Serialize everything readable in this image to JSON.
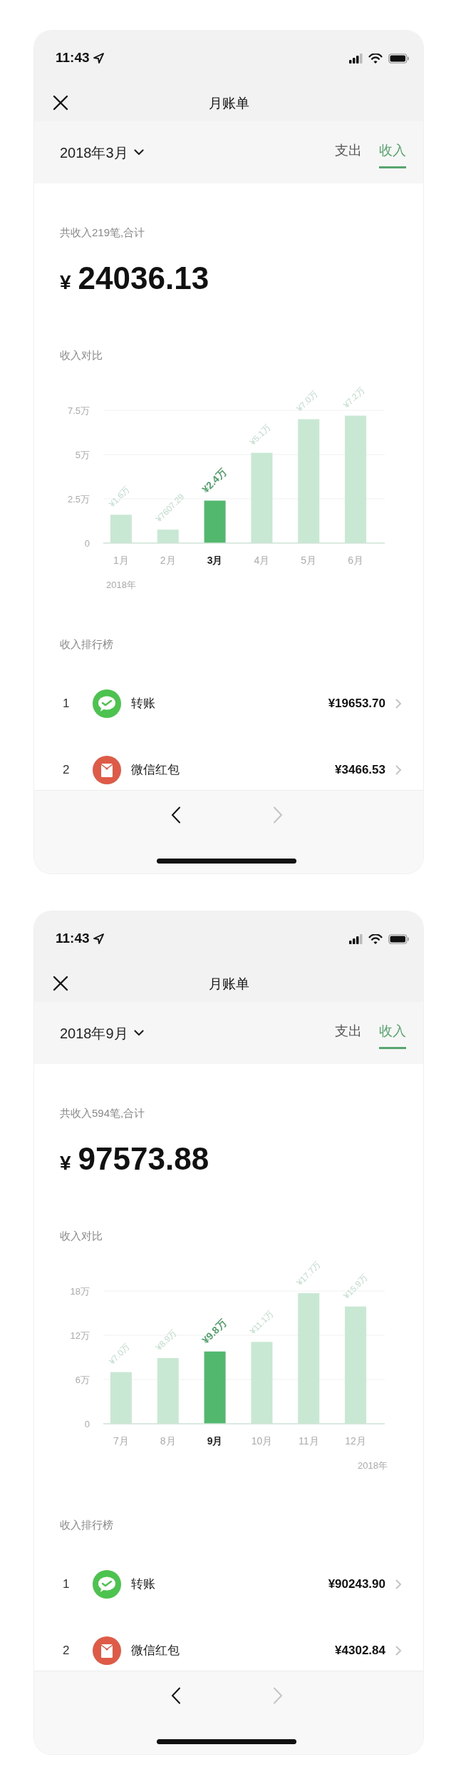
{
  "screens": [
    {
      "status_bar": {
        "time": "11:43"
      },
      "title": "月账单",
      "period": "2018年3月",
      "tabs": [
        {
          "label": "支出",
          "selected": false
        },
        {
          "label": "收入",
          "selected": true
        }
      ],
      "summary": {
        "label": "共收入219笔,合计",
        "currency": "¥",
        "amount": "24036.13"
      },
      "comparison": {
        "title": "收入对比",
        "bar_states": [
          {
            "selected": false
          },
          {
            "selected": false
          },
          {
            "selected": true
          },
          {
            "selected": false
          },
          {
            "selected": false
          },
          {
            "selected": false
          }
        ],
        "year_label_right": false,
        "chart_data": {
          "type": "bar",
          "xlabel": "2018年",
          "categories": [
            "1月",
            "2月",
            "3月",
            "4月",
            "5月",
            "6月"
          ],
          "series": [
            {
              "values": [
                1.6,
                0.76,
                2.4,
                5.1,
                7.0,
                7.2
              ]
            }
          ],
          "ylim": [
            0,
            7.5
          ],
          "yticks": [
            {
              "value": 0,
              "label": "0"
            },
            {
              "value": 2.5,
              "label": "2.5万"
            },
            {
              "value": 5,
              "label": "5万"
            },
            {
              "value": 7.5,
              "label": "7.5万"
            }
          ],
          "value_labels": [
            "¥1.6万",
            "¥7607.29",
            "¥2.4万",
            "¥5.1万",
            "¥7.0万",
            "¥7.2万"
          ]
        }
      },
      "ranking": {
        "title": "收入排行榜",
        "items": [
          {
            "rank": "1",
            "kind": "transfer",
            "name": "转账",
            "amount": "¥19653.70"
          },
          {
            "rank": "2",
            "kind": "red_packet",
            "name": "微信红包",
            "amount": "¥3466.53"
          }
        ]
      },
      "pager": {
        "prev_disabled": false,
        "next_disabled": true
      }
    },
    {
      "status_bar": {
        "time": "11:43"
      },
      "title": "月账单",
      "period": "2018年9月",
      "tabs": [
        {
          "label": "支出",
          "selected": false
        },
        {
          "label": "收入",
          "selected": true
        }
      ],
      "summary": {
        "label": "共收入594笔,合计",
        "currency": "¥",
        "amount": "97573.88"
      },
      "comparison": {
        "title": "收入对比",
        "bar_states": [
          {
            "selected": false
          },
          {
            "selected": false
          },
          {
            "selected": true
          },
          {
            "selected": false
          },
          {
            "selected": false
          },
          {
            "selected": false
          }
        ],
        "year_label_right": true,
        "chart_data": {
          "type": "bar",
          "xlabel": "2018年",
          "categories": [
            "7月",
            "8月",
            "9月",
            "10月",
            "11月",
            "12月"
          ],
          "series": [
            {
              "values": [
                7.0,
                8.9,
                9.8,
                11.1,
                17.7,
                15.9
              ]
            }
          ],
          "ylim": [
            0,
            18
          ],
          "yticks": [
            {
              "value": 0,
              "label": "0"
            },
            {
              "value": 6,
              "label": "6万"
            },
            {
              "value": 12,
              "label": "12万"
            },
            {
              "value": 18,
              "label": "18万"
            }
          ],
          "value_labels": [
            "¥7.0万",
            "¥8.9万",
            "¥9.8万",
            "¥11.1万",
            "¥17.7万",
            "¥15.9万"
          ]
        }
      },
      "ranking": {
        "title": "收入排行榜",
        "items": [
          {
            "rank": "1",
            "kind": "transfer",
            "name": "转账",
            "amount": "¥90243.90"
          },
          {
            "rank": "2",
            "kind": "red_packet",
            "name": "微信红包",
            "amount": "¥4302.84"
          }
        ]
      },
      "pager": {
        "prev_disabled": false,
        "next_disabled": true
      }
    }
  ]
}
